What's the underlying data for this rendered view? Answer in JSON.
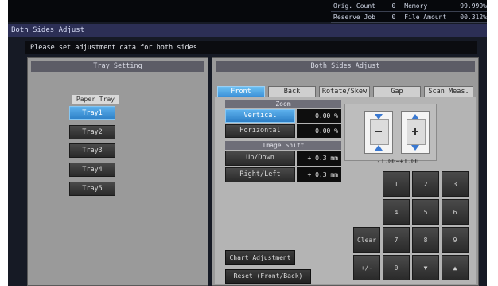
{
  "status": {
    "orig_count_label": "Orig. Count",
    "orig_count_value": "0",
    "memory_label": "Memory",
    "memory_value": "99.999%",
    "reserve_job_label": "Reserve Job",
    "reserve_job_value": "0",
    "file_amount_label": "File Amount",
    "file_amount_value": "00.312%"
  },
  "window": {
    "title": "Both Sides Adjust",
    "message": "Please set adjustment data for both sides"
  },
  "tray_setting": {
    "header": "Tray Setting",
    "paper_tray_label": "Paper Tray",
    "trays": [
      "Tray1",
      "Tray2",
      "Tray3",
      "Tray4",
      "Tray5"
    ],
    "selected": "Tray1"
  },
  "adjust": {
    "header": "Both Sides Adjust",
    "tabs": [
      "Front",
      "Back",
      "Rotate/Skew",
      "Gap",
      "Scan Meas."
    ],
    "active_tab": "Front",
    "zoom_header": "Zoom",
    "vertical_label": "Vertical",
    "vertical_value": "+0.00 %",
    "horizontal_label": "Horizontal",
    "horizontal_value": "+0.00 %",
    "image_shift_header": "Image Shift",
    "updown_label": "Up/Down",
    "updown_value": "+ 0.3 mm",
    "rightleft_label": "Right/Left",
    "rightleft_value": "+ 0.3 mm",
    "range": "-1.00~+1.00",
    "chart_adjustment": "Chart Adjustment",
    "reset_front_back": "Reset (Front/Back)"
  },
  "keypad": {
    "row1": [
      "1",
      "2",
      "3"
    ],
    "row2": [
      "4",
      "5",
      "6"
    ],
    "row3": [
      "7",
      "8",
      "9"
    ],
    "row4": [
      "0",
      "▼",
      "▲"
    ],
    "clear": "Clear",
    "plus_minus": "+/-"
  }
}
